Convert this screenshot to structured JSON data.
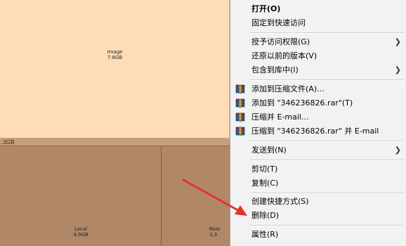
{
  "treemap": {
    "image": {
      "name": "Image",
      "size": "7.8GB"
    },
    "strip": {
      "size": ".3GB"
    },
    "local": {
      "name": "Local",
      "size": "4.9GB"
    },
    "roaming": {
      "name": "Roar",
      "size": "3.3"
    }
  },
  "menu": {
    "open": "打开(O)",
    "pin_quick_access": "固定到快速访问",
    "grant_access": "授予访问权限(G)",
    "restore_versions": "还原以前的版本(V)",
    "include_library": "包含到库中(I)",
    "add_archive": "添加到压缩文件(A)...",
    "add_to_rar": "添加到 \"346236826.rar\"(T)",
    "compress_email": "压缩并 E-mail...",
    "compress_rar_email": "压缩到 \"346236826.rar\" 并 E-mail",
    "send_to": "发送到(N)",
    "cut": "剪切(T)",
    "copy": "复制(C)",
    "create_shortcut": "创建快捷方式(S)",
    "delete": "删除(D)",
    "properties": "属性(R)"
  },
  "icons": {
    "submenu": "chevron-right-icon",
    "archive": "winrar-icon",
    "pointer": "red-arrow-icon"
  },
  "colors": {
    "pointer": "#e8302a",
    "image_block": "#ffdcb8",
    "folder_block": "#b08868"
  }
}
